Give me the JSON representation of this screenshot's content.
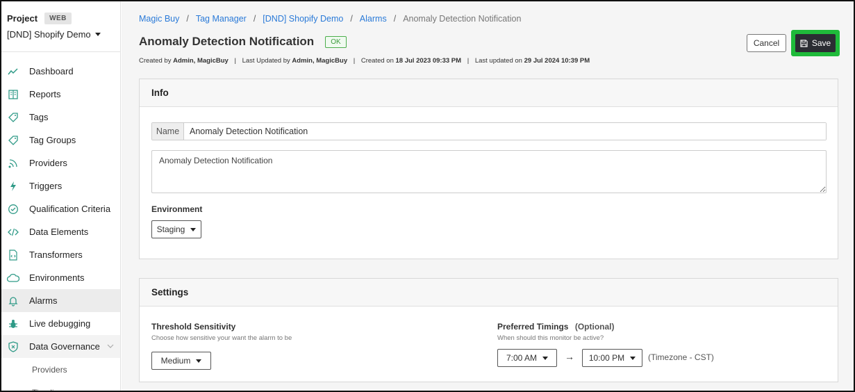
{
  "sidebar": {
    "project_label": "Project",
    "project_badge": "WEB",
    "project_name": "[DND] Shopify Demo",
    "items": [
      {
        "label": "Dashboard",
        "icon": "chart-line-icon"
      },
      {
        "label": "Reports",
        "icon": "book-icon"
      },
      {
        "label": "Tags",
        "icon": "tag-icon"
      },
      {
        "label": "Tag Groups",
        "icon": "tag-group-icon"
      },
      {
        "label": "Providers",
        "icon": "broadcast-icon"
      },
      {
        "label": "Triggers",
        "icon": "lightning-icon"
      },
      {
        "label": "Qualification Criteria",
        "icon": "check-circle-icon"
      },
      {
        "label": "Data Elements",
        "icon": "code-icon"
      },
      {
        "label": "Transformers",
        "icon": "file-code-icon"
      },
      {
        "label": "Environments",
        "icon": "cloud-icon"
      },
      {
        "label": "Alarms",
        "icon": "bell-icon"
      },
      {
        "label": "Live debugging",
        "icon": "bug-icon"
      },
      {
        "label": "Data Governance",
        "icon": "shield-icon"
      }
    ],
    "sub_items": [
      "Providers",
      "Timeline"
    ]
  },
  "breadcrumb": {
    "items": [
      "Magic Buy",
      "Tag Manager",
      "[DND] Shopify Demo",
      "Alarms"
    ],
    "current": "Anomaly Detection Notification"
  },
  "header": {
    "title": "Anomaly Detection Notification",
    "status": "OK",
    "created_by_label": "Created by",
    "created_by": "Admin, MagicBuy",
    "updated_by_label": "Last Updated by",
    "updated_by": "Admin, MagicBuy",
    "created_on_label": "Created on",
    "created_on": "18 Jul 2023 09:33 PM",
    "updated_on_label": "Last updated on",
    "updated_on": "29 Jul 2024 10:39 PM",
    "cancel_label": "Cancel",
    "save_label": "Save"
  },
  "info": {
    "section_title": "Info",
    "name_label": "Name",
    "name_value": "Anomaly Detection Notification",
    "description_value": "Anomaly Detection Notification",
    "environment_label": "Environment",
    "environment_value": "Staging"
  },
  "settings": {
    "section_title": "Settings",
    "threshold_label": "Threshold Sensitivity",
    "threshold_hint": "Choose how sensitive your want the alarm to be",
    "threshold_value": "Medium",
    "timings_label": "Preferred Timings",
    "timings_optional": "(Optional)",
    "timings_hint": "When should this monitor be active?",
    "start_time": "7:00 AM",
    "end_time": "10:00 PM",
    "timezone": "(Timezone - CST)"
  },
  "colors": {
    "accent_teal": "#2f9a87",
    "link_blue": "#2a7ad8",
    "save_highlight": "#1fba3a",
    "save_button": "#2b2d33"
  }
}
